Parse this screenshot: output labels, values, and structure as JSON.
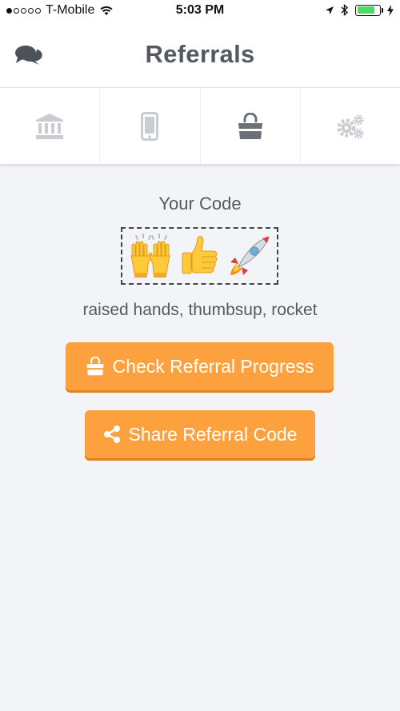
{
  "status_bar": {
    "carrier": "T-Mobile",
    "time": "5:03 PM",
    "signal_bars_filled": 1,
    "signal_bars_total": 5,
    "battery_level": 0.8,
    "icons": [
      "wifi-icon",
      "location-arrow-icon",
      "bluetooth-icon",
      "battery-icon",
      "charging-icon"
    ]
  },
  "header": {
    "title": "Referrals",
    "left_icon": "chat-bubbles-icon"
  },
  "tabs": [
    {
      "icon": "bank-icon",
      "active": false
    },
    {
      "icon": "mobile-phone-icon",
      "active": false
    },
    {
      "icon": "shopping-bag-icon",
      "active": true
    },
    {
      "icon": "gears-icon",
      "active": false
    }
  ],
  "referral": {
    "code_title": "Your Code",
    "code_emojis": [
      "raised-hands-emoji",
      "thumbsup-emoji",
      "rocket-emoji"
    ],
    "code_description": "raised hands, thumbsup, rocket"
  },
  "buttons": {
    "check_progress": {
      "label": "Check Referral Progress",
      "icon": "shopping-bag-icon"
    },
    "share_code": {
      "label": "Share Referral Code",
      "icon": "share-icon"
    }
  },
  "colors": {
    "background": "#f3f4f8",
    "button": "#fca13d",
    "active_tab_icon": "#6c7178",
    "inactive_tab_icon": "#c9cdd3",
    "battery": "#4cd964"
  }
}
